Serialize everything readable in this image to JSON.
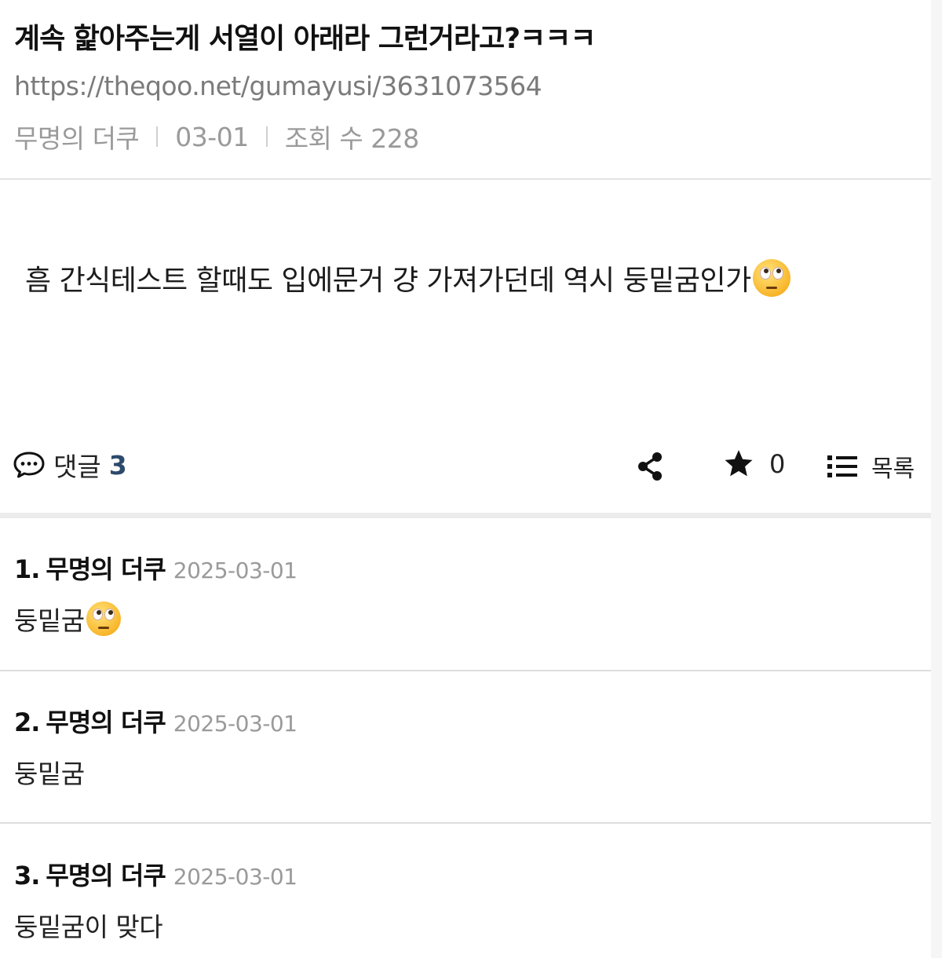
{
  "post": {
    "title": "계속 핥아주는게 서열이 아래라 그런거라고?ㅋㅋㅋ",
    "url": "https://theqoo.net/gumayusi/3631073564",
    "author": "무명의 더쿠",
    "date": "03-01",
    "views": "조회 수 228",
    "content": "흠 간식테스트 할때도 입에문거 걍 가져가던데 역시 둥밑굼인가"
  },
  "actions": {
    "comment_label": "댓글",
    "comment_count": "3",
    "star_count": "0",
    "list_label": "목록"
  },
  "comments": [
    {
      "index": "1.",
      "author": "무명의 더쿠",
      "date": "2025-03-01",
      "text": "둥밑굼"
    },
    {
      "index": "2.",
      "author": "무명의 더쿠",
      "date": "2025-03-01",
      "text": "둥밑굼"
    },
    {
      "index": "3.",
      "author": "무명의 더쿠",
      "date": "2025-03-01",
      "text": "둥밑굼이 맞다"
    }
  ],
  "icons": {
    "comment": "speech-bubble-icon",
    "share": "share-icon",
    "star": "star-icon",
    "list": "list-icon",
    "emoji": "face-with-rolling-eyes-emoji"
  },
  "colors": {
    "comment_count": "#2c4a6b",
    "meta_text": "#9a9a9a",
    "divider": "#ececec"
  }
}
